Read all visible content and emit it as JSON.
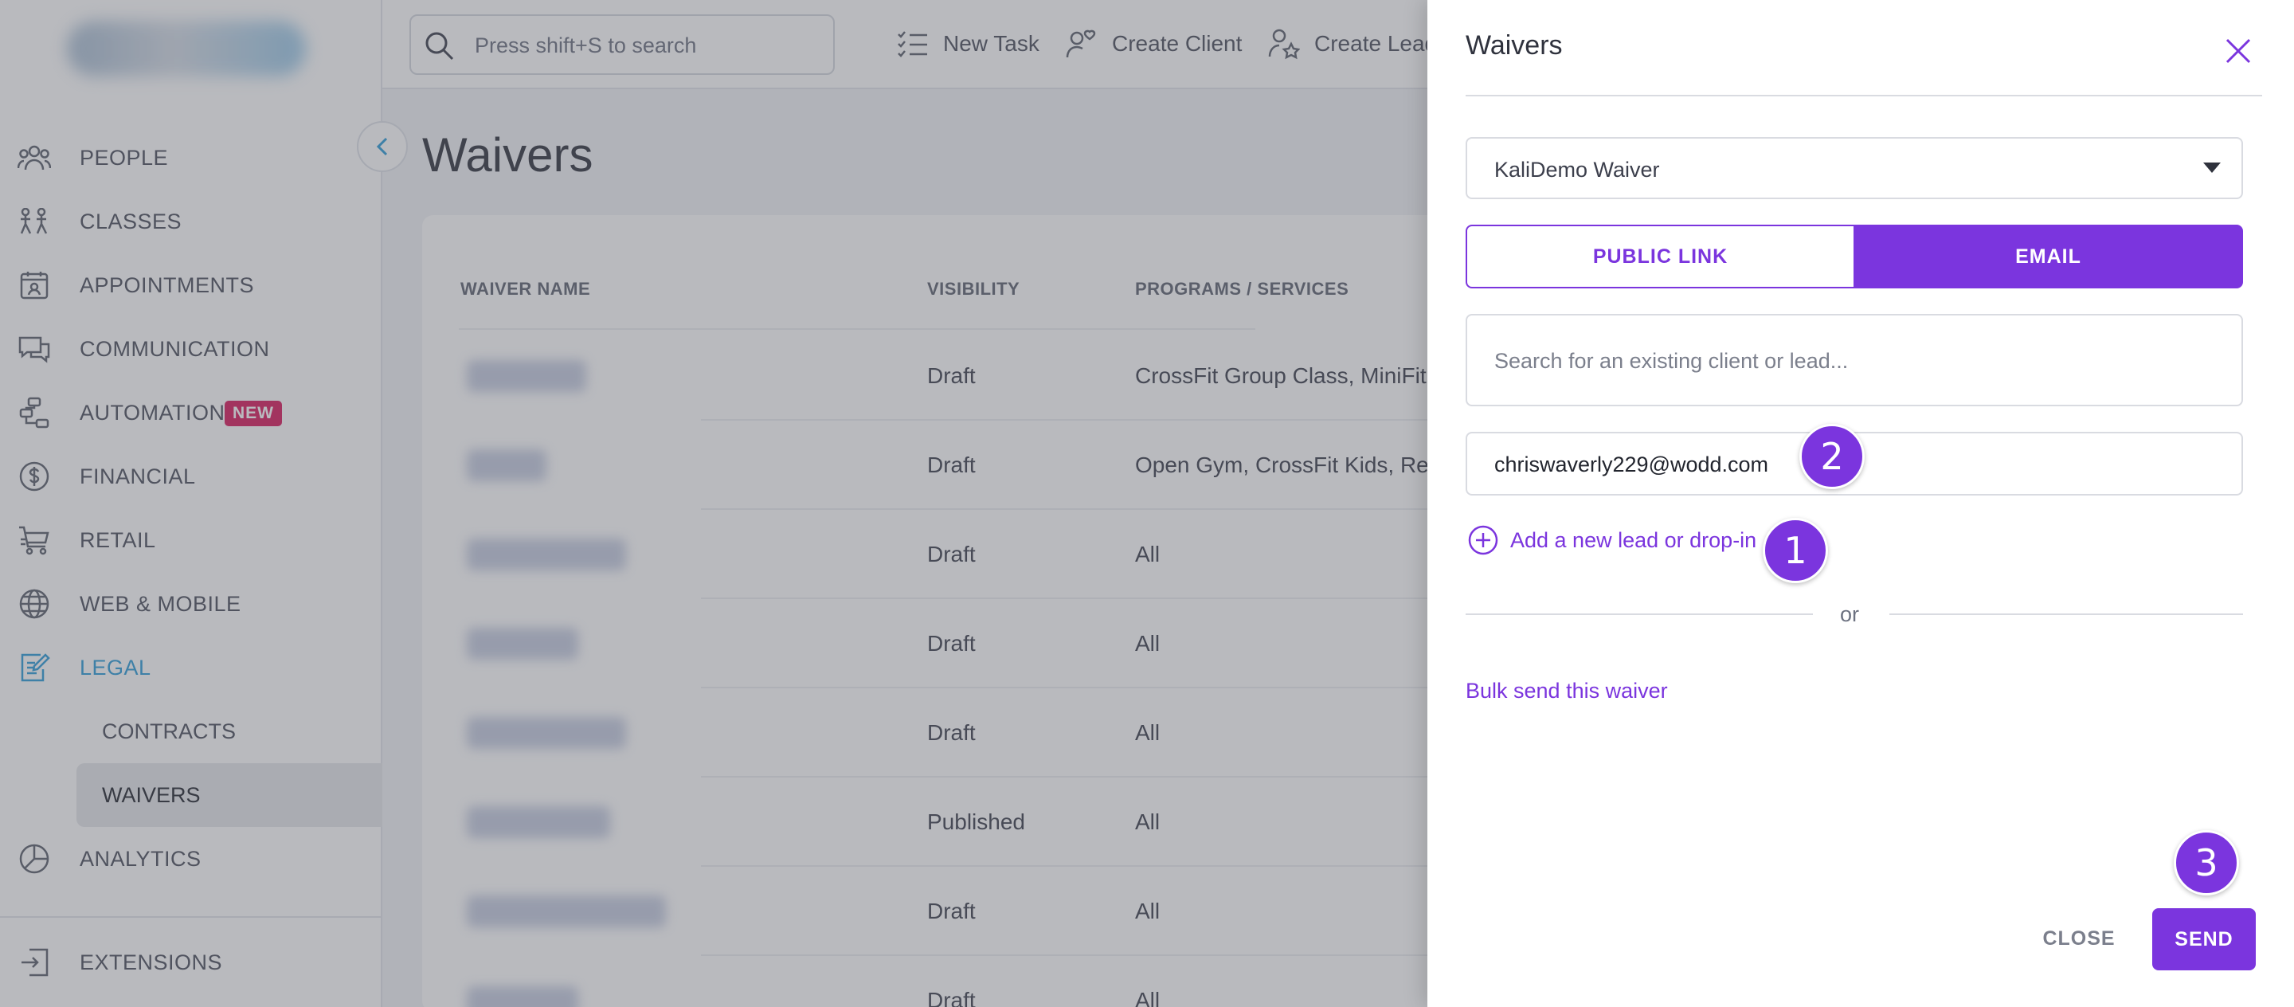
{
  "search": {
    "placeholder": "Press shift+S to search"
  },
  "topbar": {
    "new_task": "New Task",
    "create_client": "Create Client",
    "create_lead": "Create Lead"
  },
  "sidebar": {
    "items": [
      {
        "label": "PEOPLE",
        "icon": "people-icon"
      },
      {
        "label": "CLASSES",
        "icon": "classes-icon"
      },
      {
        "label": "APPOINTMENTS",
        "icon": "appointments-icon"
      },
      {
        "label": "COMMUNICATION",
        "icon": "chat-icon"
      },
      {
        "label": "AUTOMATIONS",
        "icon": "automations-icon",
        "badge": "NEW"
      },
      {
        "label": "FINANCIAL",
        "icon": "dollar-icon"
      },
      {
        "label": "RETAIL",
        "icon": "cart-icon"
      },
      {
        "label": "WEB & MOBILE",
        "icon": "globe-icon"
      },
      {
        "label": "LEGAL",
        "icon": "legal-icon",
        "active": true
      },
      {
        "label": "ANALYTICS",
        "icon": "pie-chart-icon"
      },
      {
        "label": "EXTENSIONS",
        "icon": "extensions-icon"
      }
    ],
    "legal_sub": [
      {
        "label": "CONTRACTS"
      },
      {
        "label": "WAIVERS",
        "active": true
      }
    ]
  },
  "page": {
    "title": "Waivers"
  },
  "table": {
    "headers": [
      "WAIVER NAME",
      "VISIBILITY",
      "PROGRAMS / SERVICES"
    ],
    "rows": [
      {
        "visibility": "Draft",
        "programs": "CrossFit Group Class, MiniFit Pro"
      },
      {
        "visibility": "Draft",
        "programs": "Open Gym, CrossFit Kids, Remot"
      },
      {
        "visibility": "Draft",
        "programs": "All"
      },
      {
        "visibility": "Draft",
        "programs": "All"
      },
      {
        "visibility": "Draft",
        "programs": "All"
      },
      {
        "visibility": "Published",
        "programs": "All"
      },
      {
        "visibility": "Draft",
        "programs": "All"
      },
      {
        "visibility": "Draft",
        "programs": "All"
      }
    ]
  },
  "drawer": {
    "title": "Waivers",
    "selected_waiver": "KaliDemo Waiver",
    "tabs": {
      "public_link": "PUBLIC LINK",
      "email": "EMAIL"
    },
    "active_tab": "email",
    "client_search_placeholder": "Search for an existing client or lead...",
    "email_value": "chriswaverly229@wodd.com",
    "add_lead_label": "Add a new lead or drop-in",
    "or_text": "or",
    "bulk_send_label": "Bulk send this waiver",
    "close_label": "CLOSE",
    "send_label": "SEND"
  },
  "steps": [
    "1",
    "2",
    "3"
  ],
  "colors": {
    "accent": "#7b35de",
    "active_nav": "#2b9bd8",
    "badge_new": "#d8195c"
  }
}
